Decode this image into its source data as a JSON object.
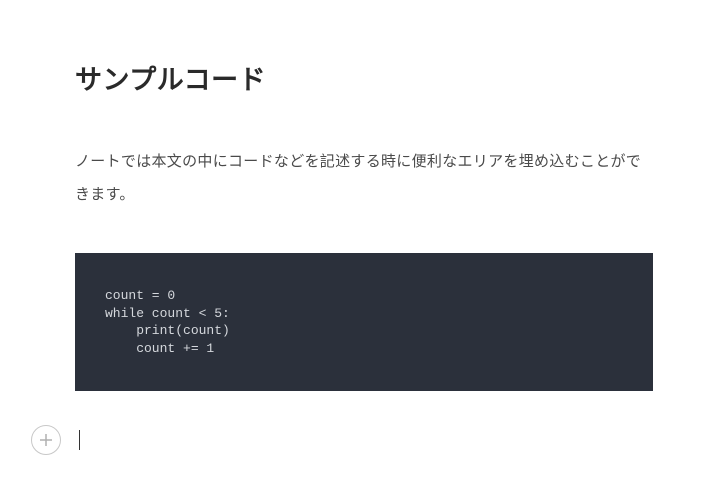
{
  "heading": "サンプルコード",
  "body_text": "ノートでは本文の中にコードなどを記述する時に便利なエリアを埋め込むことができます。",
  "code_block": "count = 0\nwhile count < 5:\n    print(count)\n    count += 1"
}
